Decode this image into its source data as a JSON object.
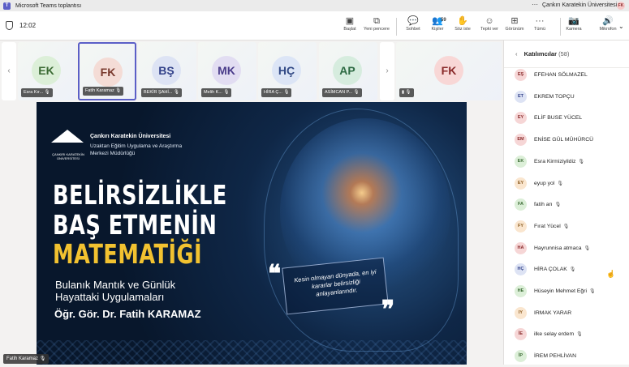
{
  "titlebar": {
    "app_title": "Microsoft Teams toplantısı",
    "org": "Çankırı Karatekin Üniversitesi",
    "user_initials": "FK",
    "more": "···"
  },
  "toolbar": {
    "timer": "12:02",
    "buttons": [
      {
        "label": "Başlat",
        "icon": "screen-share-icon",
        "glyph": "▣"
      },
      {
        "label": "Yeni pencere",
        "icon": "new-window-icon",
        "glyph": "⧉"
      },
      {
        "label": "Sohbet",
        "icon": "chat-icon",
        "glyph": "💬"
      },
      {
        "label": "Kişiler",
        "icon": "people-icon",
        "glyph": "👥",
        "count": "59"
      },
      {
        "label": "Söz iste",
        "icon": "raise-hand-icon",
        "glyph": "✋"
      },
      {
        "label": "Tepki ver",
        "icon": "reaction-icon",
        "glyph": "☺"
      },
      {
        "label": "Görünüm",
        "icon": "view-icon",
        "glyph": "⊞"
      },
      {
        "label": "Tümü",
        "icon": "more-icon",
        "glyph": "···"
      },
      {
        "label": "Kamera",
        "icon": "camera-off-icon",
        "glyph": "📷"
      },
      {
        "label": "Mikrofon",
        "icon": "microphone-icon",
        "glyph": "🔊"
      }
    ]
  },
  "tiles": [
    {
      "initials": "EK",
      "name": "Esra Kır...",
      "bg": "#dcefd8",
      "fg": "#3c6b34"
    },
    {
      "initials": "FK",
      "name": "Fatih Karamaz",
      "bg": "#f4dcd6",
      "fg": "#7a3a2e"
    },
    {
      "initials": "BŞ",
      "name": "BEKİR ŞAHİ...",
      "bg": "#dde3f4",
      "fg": "#33428a"
    },
    {
      "initials": "MK",
      "name": "Melih K...",
      "bg": "#e2ddf2",
      "fg": "#4a3c8a"
    },
    {
      "initials": "HÇ",
      "name": "HİRA Ç...",
      "bg": "#dce5f6",
      "fg": "#324a86"
    },
    {
      "initials": "AP",
      "name": "ASİMCAN P...",
      "bg": "#d6ecde",
      "fg": "#2d6a43"
    },
    {
      "initials": "FK",
      "name": "",
      "bg": "#f8d7d6",
      "fg": "#8a2b2b"
    }
  ],
  "slide": {
    "university": "Çankırı Karatekin Üniversitesi",
    "center": "Uzaktan Eğitim Uygulama ve Araştırma Merkezi Müdürlüğü",
    "logo_caption": "ÇANKIRI KARATEKİN ÜNİVERSİTESİ",
    "title_line1": "BELİRSİZLİKLE",
    "title_line2": "BAŞ ETMENİN",
    "title_line3": "MATEMATİĞİ",
    "subtitle": "Bulanık Mantık ve Günlük Hayattaki Uygulamaları",
    "author": "Öğr. Gör. Dr. Fatih KARAMAZ",
    "quote": "Kesin olmayan dünyada, en iyi kararlar belirsizliği anlayanlarındır.",
    "quote_open": "❝",
    "quote_close": "❞"
  },
  "presenter_tag": "Fatih Karamaz",
  "panel": {
    "title": "Katılımcılar",
    "count": "(58)",
    "participants": [
      {
        "initials": "EŞ",
        "name": "EFEHAN SÖLMAZEL",
        "bg": "#f6d6d6",
        "fg": "#8a2b2b",
        "mic": false
      },
      {
        "initials": "ET",
        "name": "EKREM TOPÇU",
        "bg": "#dde3f4",
        "fg": "#33428a",
        "mic": false
      },
      {
        "initials": "EY",
        "name": "ELİF BUSE YÜCEL",
        "bg": "#f6d6d6",
        "fg": "#8a2b2b",
        "mic": false
      },
      {
        "initials": "EM",
        "name": "ENİSE GÜL MÜHÜRCÜ",
        "bg": "#f6d6d6",
        "fg": "#8a2b2b",
        "mic": false
      },
      {
        "initials": "EK",
        "name": "Esra Kirmiziyildiz",
        "bg": "#dcefd8",
        "fg": "#3c6b34",
        "mic": true
      },
      {
        "initials": "EY",
        "name": "eyup yol",
        "bg": "#fae6cf",
        "fg": "#8a5a1e",
        "mic": true
      },
      {
        "initials": "FA",
        "name": "fatih arı",
        "bg": "#dcefd8",
        "fg": "#3c6b34",
        "mic": true
      },
      {
        "initials": "FY",
        "name": "Fırat Yücel",
        "bg": "#fae6cf",
        "fg": "#8a5a1e",
        "mic": true
      },
      {
        "initials": "HA",
        "name": "Hayrunnisa atmaca",
        "bg": "#f6d6d6",
        "fg": "#8a2b2b",
        "mic": true
      },
      {
        "initials": "HÇ",
        "name": "HİRA ÇOLAK",
        "bg": "#dde3f4",
        "fg": "#33428a",
        "mic": true
      },
      {
        "initials": "HE",
        "name": "Hüseyin Mehmet Eğri",
        "bg": "#dcefd8",
        "fg": "#3c6b34",
        "mic": true
      },
      {
        "initials": "IY",
        "name": "IRMAK YARAR",
        "bg": "#fae6cf",
        "fg": "#8a5a1e",
        "mic": false
      },
      {
        "initials": "İE",
        "name": "ilke selay erdem",
        "bg": "#f6d6d6",
        "fg": "#8a2b2b",
        "mic": true
      },
      {
        "initials": "İP",
        "name": "İREM PEHLİVAN",
        "bg": "#dcefd8",
        "fg": "#3c6b34",
        "mic": false
      }
    ]
  }
}
